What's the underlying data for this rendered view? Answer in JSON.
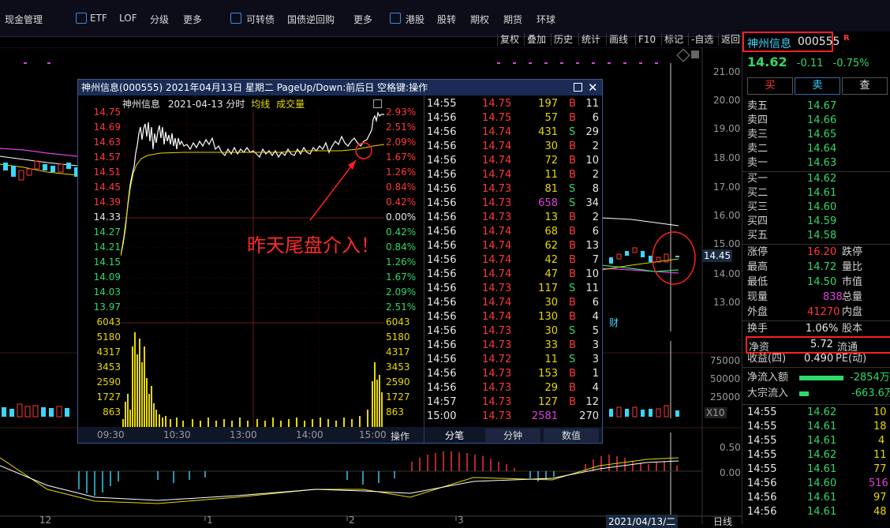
{
  "menubar": {
    "items": [
      "现金管理",
      "ETF",
      "LOF",
      "分级",
      "更多",
      "可转债",
      "国债逆回购",
      "更多",
      "港股",
      "股转",
      "期权",
      "期货",
      "环球"
    ]
  },
  "toolbar": {
    "items": [
      "复权",
      "叠加",
      "历史",
      "统计",
      "画线",
      "F10",
      "标记",
      "-自选",
      "返回"
    ]
  },
  "main_chart": {
    "price_axis": [
      "21.00",
      "20.00",
      "19.00",
      "18.00",
      "17.00",
      "16.00",
      "15.00",
      "14.00",
      "13.00"
    ],
    "current_price_tag": "14.45",
    "volume_axis": [
      "75000",
      "50000",
      "25000"
    ],
    "volume_unit": "X10",
    "macd_axis": [
      "0.50",
      "0.00"
    ],
    "date_labels": [
      "12",
      "1",
      "2",
      "3"
    ],
    "date_cursor": "2021/04/13/二",
    "period_label": "日线",
    "fin_marker": "财"
  },
  "popup": {
    "window_title": "神州信息(000555) 2021年04月13日 星期二 PageUp/Down:前后日 空格键:操作",
    "chart_header": {
      "name": "神州信息",
      "date": "2021-04-13 分时",
      "avg_label": "均线",
      "vol_label": "成交量"
    },
    "annotation": "昨天尾盘介入！",
    "price_ticks": [
      "14.75",
      "14.69",
      "14.63",
      "14.57",
      "14.51",
      "14.45",
      "14.39",
      "14.33",
      "14.27",
      "14.21",
      "14.15",
      "14.09",
      "14.03",
      "13.97"
    ],
    "pct_ticks": [
      "2.93%",
      "2.51%",
      "2.09%",
      "1.67%",
      "1.26%",
      "0.84%",
      "0.42%",
      "0.00%",
      "0.42%",
      "0.84%",
      "1.26%",
      "1.67%",
      "2.09%",
      "2.51%"
    ],
    "vol_ticks": [
      "6043",
      "5180",
      "4317",
      "3453",
      "2590",
      "1727",
      "863"
    ],
    "time_ticks": [
      "09:30",
      "10:30",
      "13:00",
      "14:00",
      "15:00"
    ],
    "op_label": "操作",
    "ticks_table": [
      [
        "14:55",
        "14.75",
        "197",
        "B",
        "11"
      ],
      [
        "14:56",
        "14.75",
        "57",
        "B",
        "6"
      ],
      [
        "14:56",
        "14.74",
        "431",
        "S",
        "29"
      ],
      [
        "14:56",
        "14.74",
        "30",
        "B",
        "2"
      ],
      [
        "14:56",
        "14.74",
        "72",
        "B",
        "10"
      ],
      [
        "14:56",
        "14.74",
        "11",
        "B",
        "2"
      ],
      [
        "14:56",
        "14.73",
        "81",
        "S",
        "8"
      ],
      [
        "14:56",
        "14.73",
        "658",
        "S",
        "34"
      ],
      [
        "14:56",
        "14.73",
        "13",
        "B",
        "2"
      ],
      [
        "14:56",
        "14.74",
        "68",
        "B",
        "6"
      ],
      [
        "14:56",
        "14.74",
        "62",
        "B",
        "13"
      ],
      [
        "14:56",
        "14.74",
        "42",
        "B",
        "7"
      ],
      [
        "14:56",
        "14.74",
        "47",
        "B",
        "10"
      ],
      [
        "14:56",
        "14.73",
        "117",
        "S",
        "11"
      ],
      [
        "14:56",
        "14.74",
        "30",
        "B",
        "6"
      ],
      [
        "14:56",
        "14.74",
        "130",
        "B",
        "4"
      ],
      [
        "14:56",
        "14.73",
        "30",
        "S",
        "5"
      ],
      [
        "14:56",
        "14.73",
        "33",
        "B",
        "3"
      ],
      [
        "14:56",
        "14.72",
        "11",
        "S",
        "3"
      ],
      [
        "14:56",
        "14.73",
        "153",
        "B",
        "1"
      ],
      [
        "14:56",
        "14.73",
        "29",
        "B",
        "4"
      ],
      [
        "14:57",
        "14.73",
        "127",
        "B",
        "12"
      ],
      [
        "15:00",
        "14.73",
        "2581",
        "",
        "270"
      ]
    ],
    "tabs": [
      "分笔",
      "分钟",
      "数值"
    ]
  },
  "stock": {
    "name": "神州信息",
    "code": "000555",
    "flag": "R",
    "price": "14.62",
    "change": "-0.11",
    "change_pct": "-0.75%",
    "buy_btn": "买",
    "sell_btn": "卖",
    "check_btn": "查",
    "asks": [
      {
        "label": "卖五",
        "price": "14.67"
      },
      {
        "label": "卖四",
        "price": "14.66"
      },
      {
        "label": "卖三",
        "price": "14.65"
      },
      {
        "label": "卖二",
        "price": "14.64"
      },
      {
        "label": "卖一",
        "price": "14.63"
      }
    ],
    "bids": [
      {
        "label": "买一",
        "price": "14.62"
      },
      {
        "label": "买二",
        "price": "14.61"
      },
      {
        "label": "买三",
        "price": "14.60"
      },
      {
        "label": "买四",
        "price": "14.59"
      },
      {
        "label": "买五",
        "price": "14.58"
      }
    ],
    "stats": [
      {
        "l1": "涨停",
        "v1": "16.20",
        "l2": "跌停"
      },
      {
        "l1": "最高",
        "v1": "14.72",
        "l2": "量比"
      },
      {
        "l1": "最低",
        "v1": "14.50",
        "l2": "市值"
      },
      {
        "l1": "现量",
        "v1": "838",
        "l2": "总量"
      },
      {
        "l1": "外盘",
        "v1": "41270",
        "l2": "内盘"
      }
    ],
    "turnover": {
      "label": "换手",
      "value": "1.06%",
      "label2": "股本"
    },
    "net_asset": {
      "label": "净资",
      "value": "5.72",
      "label2": "流通"
    },
    "eps": {
      "label": "收益(四)",
      "value": "0.490",
      "label2": "PE(动)"
    },
    "net_inflow": {
      "label": "净流入额",
      "value": "-2854万"
    },
    "block_inflow": {
      "label": "大宗流入",
      "value": "-663.6万"
    },
    "recent_ticks": [
      [
        "14:55",
        "14.62",
        "10"
      ],
      [
        "14:55",
        "14.61",
        "18"
      ],
      [
        "14:55",
        "14.61",
        "4"
      ],
      [
        "14:55",
        "14.62",
        "11"
      ],
      [
        "14:55",
        "14.61",
        "77"
      ],
      [
        "14:56",
        "14.60",
        "516"
      ],
      [
        "14:56",
        "14.61",
        "97"
      ],
      [
        "14:56",
        "14.61",
        "48"
      ]
    ]
  },
  "colors": {
    "up": "#ff3838",
    "down": "#2fd86a",
    "accent": "#3ad6ff",
    "avg": "#e8d800"
  }
}
